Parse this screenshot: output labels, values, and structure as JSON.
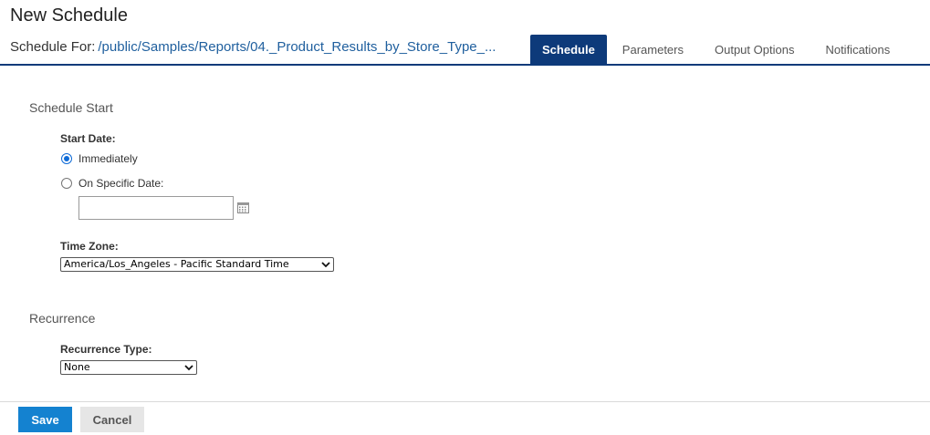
{
  "header": {
    "title": "New Schedule",
    "schedule_for_label": "Schedule For:",
    "schedule_for_path": "/public/Samples/Reports/04._Product_Results_by_Store_Type_..."
  },
  "tabs": [
    {
      "label": "Schedule",
      "active": true
    },
    {
      "label": "Parameters",
      "active": false
    },
    {
      "label": "Output Options",
      "active": false
    },
    {
      "label": "Notifications",
      "active": false
    }
  ],
  "schedule_start": {
    "title": "Schedule Start",
    "start_date_label": "Start Date:",
    "options": [
      {
        "label": "Immediately",
        "checked": true
      },
      {
        "label": "On Specific Date:",
        "checked": false
      }
    ],
    "date_value": "",
    "time_zone_label": "Time Zone:",
    "time_zone_value": "America/Los_Angeles - Pacific Standard Time"
  },
  "recurrence": {
    "title": "Recurrence",
    "type_label": "Recurrence Type:",
    "type_value": "None"
  },
  "footer": {
    "save_label": "Save",
    "cancel_label": "Cancel"
  },
  "colors": {
    "accent": "#0d3a7a",
    "primary_button": "#1482d0",
    "link": "#1f5f9e"
  }
}
